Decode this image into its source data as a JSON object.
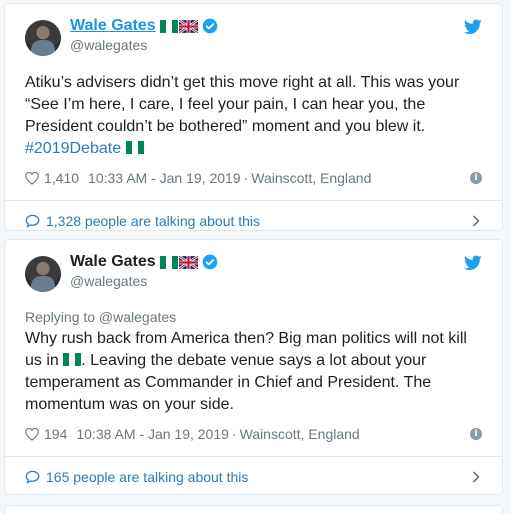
{
  "tweets": [
    {
      "display_name": "Wale Gates",
      "handle": "@walegates",
      "reply_to": "",
      "text_before_hashtag": "Atiku’s advisers didn’t get this move right at all. This was your “See I’m here, I care, I feel your pain, I can hear you, the President couldn’t be bothered” moment and you blew it. ",
      "hashtag": "#2019Debate",
      "likes": "1,410",
      "time": "10:33 AM - Jan 19, 2019",
      "location": "Wainscott, England",
      "talking": "1,328 people are talking about this"
    },
    {
      "display_name": "Wale Gates",
      "handle": "@walegates",
      "reply_to": "Replying to @walegates",
      "text_part1": "Why rush back from America then? Big man politics will not kill us in ",
      "text_part2": ". Leaving the debate venue says a lot about your temperament as Commander in Chief and President. The momentum was on your side.",
      "likes": "194",
      "time": "10:38 AM - Jan 19, 2019",
      "location": "Wainscott, England",
      "talking": "165 people are talking about this"
    }
  ],
  "separator": "·",
  "info_glyph": "i",
  "colors": {
    "link_blue": "#1b95e0",
    "hashtag_blue": "#2b7bb9",
    "muted": "#697882",
    "nigeria_green": "#008751",
    "twitter_blue": "#1da1f2"
  },
  "icons": [
    "twitter-bird-icon",
    "verified-badge-icon",
    "heart-icon",
    "info-icon",
    "speech-bubble-icon",
    "chevron-right-icon",
    "nigeria-flag-icon",
    "uk-flag-icon"
  ]
}
